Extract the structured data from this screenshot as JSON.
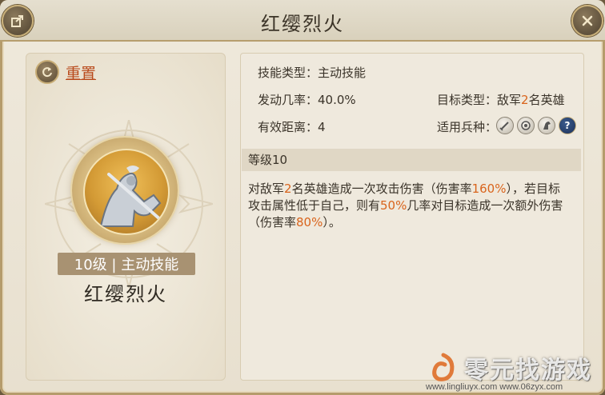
{
  "header": {
    "title": "红缨烈火"
  },
  "left": {
    "reset_label": "重置",
    "level_badge": "10级 | 主动技能",
    "skill_name": "红缨烈火"
  },
  "info": {
    "skill_type": "技能类型：主动技能",
    "trigger_rate": "发动几率：40.0%",
    "range": "有效距离：4",
    "target_prefix": "目标类型：敌军",
    "target_count": "2",
    "target_suffix": "名英雄",
    "troop_label": "适用兵种：",
    "troop_icons": [
      "sword-icon",
      "bow-icon",
      "horse-icon",
      "question-icon"
    ],
    "question_glyph": "?"
  },
  "level": {
    "header": "等级10",
    "desc": {
      "p1": "对敌军",
      "n1": "2",
      "p2": "名英雄造成一次攻击伤害（伤害率",
      "n2": "160%",
      "p3": "），若目标攻击属性低于自己，则有",
      "n3": "50%",
      "p4": "几率对目标造成一次额外伤害（伤害率",
      "n4": "80%",
      "p5": "）。"
    }
  },
  "watermark": {
    "text": "零元找游戏",
    "url": "www.lingliuyx.com  www.06zyx.com"
  },
  "colors": {
    "accent": "#d9641c",
    "reset": "#b94a1c",
    "frame": "#b69e6e"
  }
}
